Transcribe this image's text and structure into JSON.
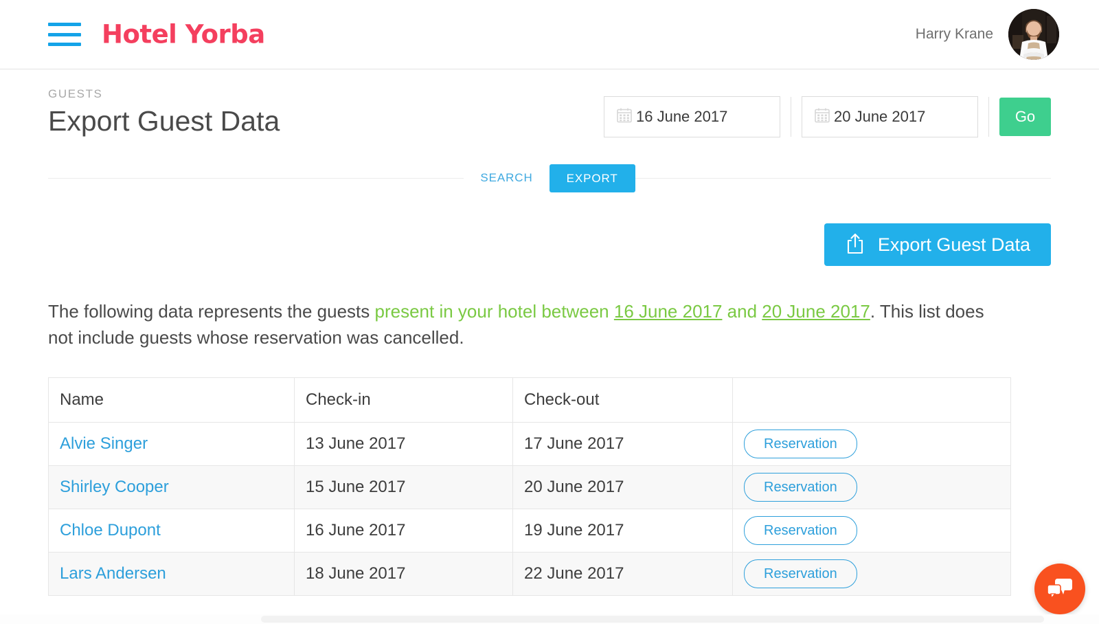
{
  "header": {
    "menu_icon": "hamburger-menu-icon",
    "brand": "Hotel Yorba",
    "brand_color": "#f43f5e",
    "menu_color": "#14a3e8",
    "user_name": "Harry Krane",
    "avatar_alt": "user-avatar"
  },
  "page": {
    "eyebrow": "GUESTS",
    "title": "Export Guest Data"
  },
  "date_range": {
    "start": {
      "value": "16 June 2017",
      "icon": "calendar-icon"
    },
    "end": {
      "value": "20 June 2017",
      "icon": "calendar-icon"
    },
    "go_label": "Go",
    "go_color": "#3ecf8e"
  },
  "tabs": [
    {
      "label": "SEARCH",
      "active": false
    },
    {
      "label": "EXPORT",
      "active": true
    }
  ],
  "export_button": {
    "label": "Export Guest Data",
    "icon": "share-upload-icon",
    "color": "#22b0ea"
  },
  "description": {
    "part1": "The following data represents the guests ",
    "green1": "present in your hotel between ",
    "date1": "16 June 2017",
    "green2": " and ",
    "date2": "20 June 2017",
    "part2": ". This list does not include guests whose reservation was cancelled."
  },
  "table": {
    "columns": [
      "Name",
      "Check-in",
      "Check-out",
      ""
    ],
    "rows": [
      {
        "name": "Alvie Singer",
        "check_in": "13 June 2017",
        "check_out": "17 June 2017",
        "action": "Reservation"
      },
      {
        "name": "Shirley Cooper",
        "check_in": "15 June 2017",
        "check_out": "20 June 2017",
        "action": "Reservation"
      },
      {
        "name": "Chloe Dupont",
        "check_in": "16 June 2017",
        "check_out": "19 June 2017",
        "action": "Reservation"
      },
      {
        "name": "Lars Andersen",
        "check_in": "18 June 2017",
        "check_out": "22 June 2017",
        "action": "Reservation"
      }
    ]
  },
  "chat_widget": {
    "icon": "chat-bubbles-icon",
    "color": "#f9511f"
  }
}
